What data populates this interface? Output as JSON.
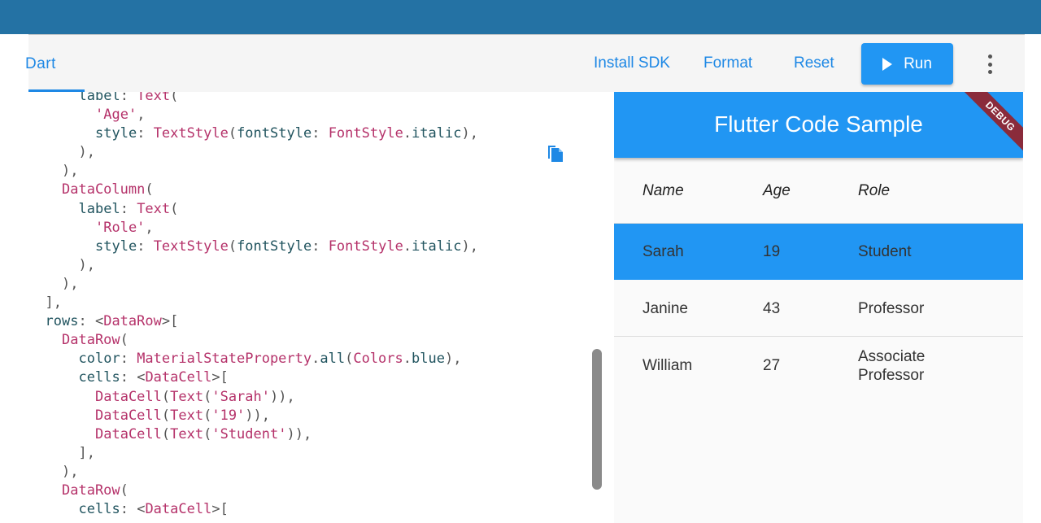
{
  "toolbar": {
    "tab_label": "Dart",
    "install_sdk": "Install SDK",
    "format": "Format",
    "reset": "Reset",
    "run": "Run"
  },
  "editor": {
    "lines": [
      "      label: Text(",
      "        'Age',",
      "        style: TextStyle(fontStyle: FontStyle.italic),",
      "      ),",
      "    ),",
      "    DataColumn(",
      "      label: Text(",
      "        'Role',",
      "        style: TextStyle(fontStyle: FontStyle.italic),",
      "      ),",
      "    ),",
      "  ],",
      "  rows: <DataRow>[",
      "    DataRow(",
      "      color: MaterialStateProperty.all(Colors.blue),",
      "      cells: <DataCell>[",
      "        DataCell(Text('Sarah')),",
      "        DataCell(Text('19')),",
      "        DataCell(Text('Student')),",
      "      ],",
      "    ),",
      "    DataRow(",
      "      cells: <DataCell>["
    ]
  },
  "preview": {
    "app_title": "Flutter Code Sample",
    "debug_banner": "DEBUG",
    "columns": [
      "Name",
      "Age",
      "Role"
    ],
    "rows": [
      {
        "name": "Sarah",
        "age": "19",
        "role": "Student",
        "highlighted": true
      },
      {
        "name": "Janine",
        "age": "43",
        "role": "Professor",
        "highlighted": false
      },
      {
        "name": "William",
        "age": "27",
        "role": "Associate Professor",
        "highlighted": false
      }
    ],
    "highlight_color": "#2196f3"
  },
  "colors": {
    "top_bar": "#2472a4",
    "accent": "#1e88e5",
    "run_button": "#2196f3"
  }
}
